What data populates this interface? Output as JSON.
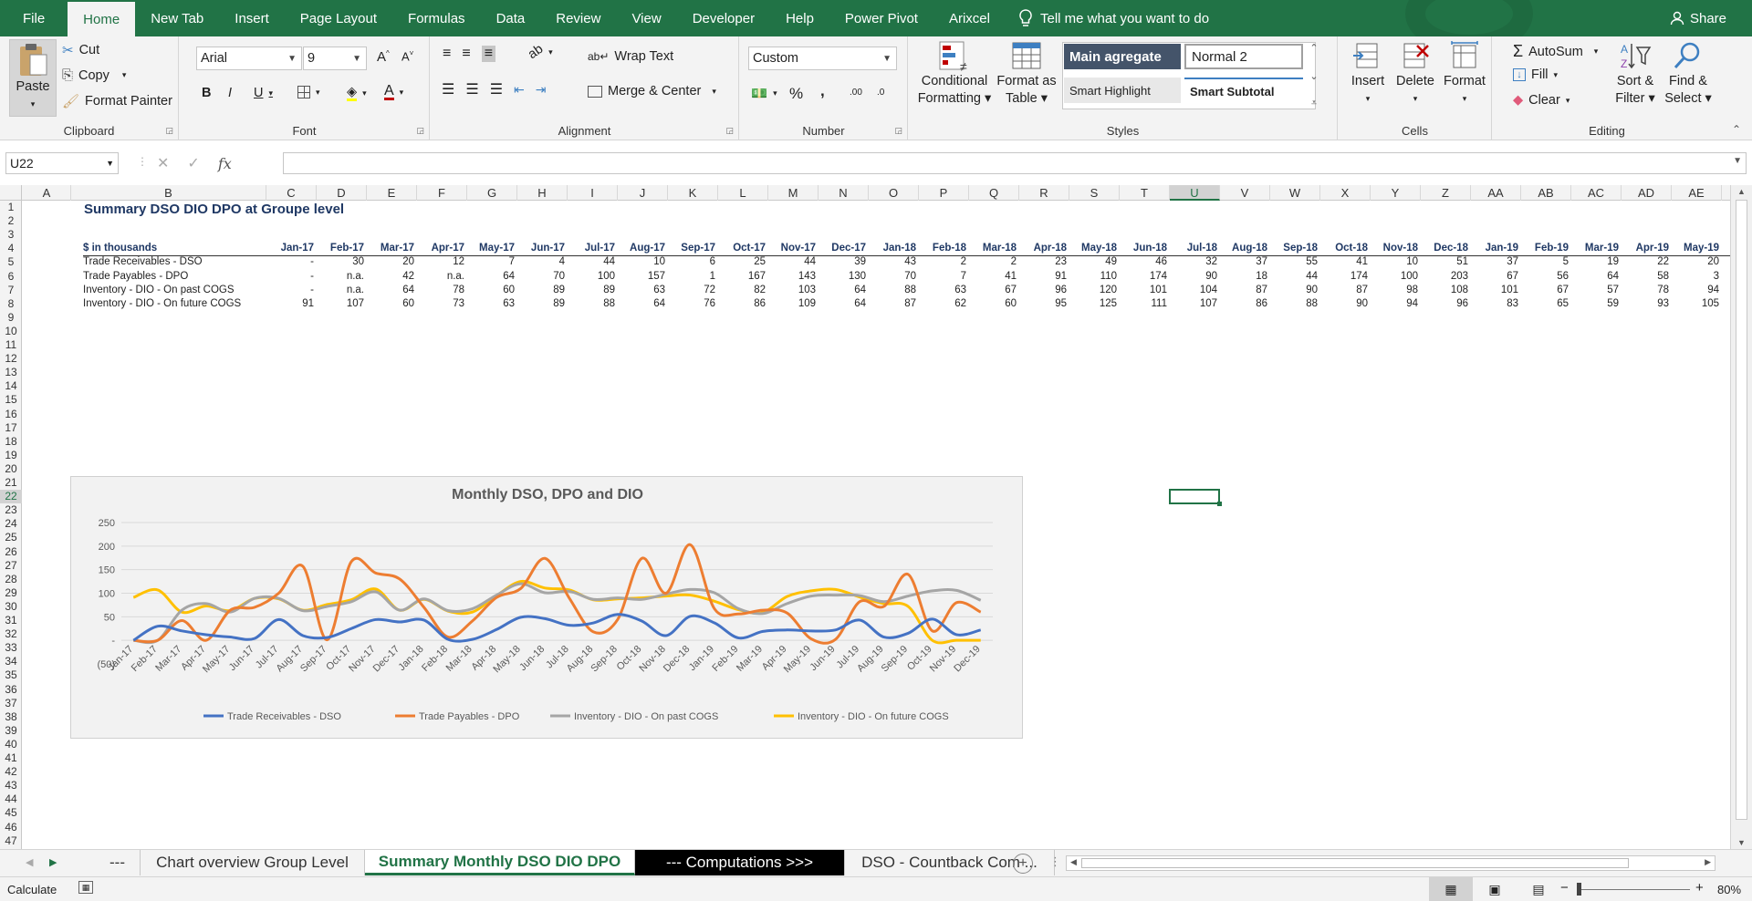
{
  "menu": {
    "file": "File",
    "tabs": [
      "Home",
      "New Tab",
      "Insert",
      "Page Layout",
      "Formulas",
      "Data",
      "Review",
      "View",
      "Developer",
      "Help",
      "Power Pivot",
      "Arixcel"
    ],
    "tell_me": "Tell me what you want to do",
    "share": "Share"
  },
  "ribbon": {
    "clipboard": {
      "paste": "Paste",
      "cut": "Cut",
      "copy": "Copy",
      "format_painter": "Format Painter",
      "label": "Clipboard"
    },
    "font": {
      "name": "Arial",
      "size": "9",
      "bold": "B",
      "italic": "I",
      "underline": "U",
      "label": "Font"
    },
    "alignment": {
      "wrap_text": "Wrap Text",
      "merge_center": "Merge & Center",
      "label": "Alignment"
    },
    "number": {
      "format": "Custom",
      "percent": "%",
      "comma": ",",
      "inc_decimal": ".00",
      "dec_decimal": ".0",
      "label": "Number"
    },
    "styles": {
      "conditional_formatting": [
        "Conditional",
        "Formatting"
      ],
      "format_as_table": [
        "Format as",
        "Table"
      ],
      "gallery": [
        "Main agregate",
        "Normal 2",
        "Smart Highlight",
        "Smart Subtotal"
      ],
      "label": "Styles"
    },
    "cells": {
      "insert": "Insert",
      "delete": "Delete",
      "format": "Format",
      "label": "Cells"
    },
    "editing": {
      "autosum": "AutoSum",
      "fill": "Fill",
      "clear": "Clear",
      "sort_filter": [
        "Sort &",
        "Filter"
      ],
      "find_select": [
        "Find &",
        "Select"
      ],
      "label": "Editing"
    }
  },
  "formula_bar": {
    "name_box": "U22",
    "cancel": "✕",
    "enter": "✓",
    "fx": "fx",
    "formula": ""
  },
  "columns": [
    "A",
    "B",
    "C",
    "D",
    "E",
    "F",
    "G",
    "H",
    "I",
    "J",
    "K",
    "L",
    "M",
    "N",
    "O",
    "P",
    "Q",
    "R",
    "S",
    "T",
    "U",
    "V",
    "W",
    "X",
    "Y",
    "Z",
    "AA",
    "AB",
    "AC",
    "AD",
    "AE"
  ],
  "selected_column": "U",
  "selected_row": 22,
  "row_count": 47,
  "sheet": {
    "title": "Summary DSO DIO DPO at Groupe level",
    "header_label": "$ in thousands",
    "months": [
      "Jan-17",
      "Feb-17",
      "Mar-17",
      "Apr-17",
      "May-17",
      "Jun-17",
      "Jul-17",
      "Aug-17",
      "Sep-17",
      "Oct-17",
      "Nov-17",
      "Dec-17",
      "Jan-18",
      "Feb-18",
      "Mar-18",
      "Apr-18",
      "May-18",
      "Jun-18",
      "Jul-18",
      "Aug-18",
      "Sep-18",
      "Oct-18",
      "Nov-18",
      "Dec-18",
      "Jan-19",
      "Feb-19",
      "Mar-19",
      "Apr-19",
      "May-19"
    ],
    "rows": [
      {
        "label": "Trade Receivables - DSO",
        "values": [
          "-",
          "30",
          "20",
          "12",
          "7",
          "4",
          "44",
          "10",
          "6",
          "25",
          "44",
          "39",
          "43",
          "2",
          "2",
          "23",
          "49",
          "46",
          "32",
          "37",
          "55",
          "41",
          "10",
          "51",
          "37",
          "5",
          "19",
          "22",
          "20"
        ]
      },
      {
        "label": "Trade Payables - DPO",
        "values": [
          "-",
          "n.a.",
          "42",
          "n.a.",
          "64",
          "70",
          "100",
          "157",
          "1",
          "167",
          "143",
          "130",
          "70",
          "7",
          "41",
          "91",
          "110",
          "174",
          "90",
          "18",
          "44",
          "174",
          "100",
          "203",
          "67",
          "56",
          "64",
          "58",
          "3"
        ]
      },
      {
        "label": "Inventory - DIO - On past COGS",
        "values": [
          "-",
          "n.a.",
          "64",
          "78",
          "60",
          "89",
          "89",
          "63",
          "72",
          "82",
          "103",
          "64",
          "88",
          "63",
          "67",
          "96",
          "120",
          "101",
          "104",
          "87",
          "90",
          "87",
          "98",
          "108",
          "101",
          "67",
          "57",
          "78",
          "94"
        ]
      },
      {
        "label": "Inventory - DIO - On future COGS",
        "values": [
          "91",
          "107",
          "60",
          "73",
          "63",
          "89",
          "88",
          "64",
          "76",
          "86",
          "109",
          "64",
          "87",
          "62",
          "60",
          "95",
          "125",
          "111",
          "107",
          "86",
          "88",
          "90",
          "94",
          "96",
          "83",
          "65",
          "59",
          "93",
          "105"
        ]
      }
    ]
  },
  "chart_data": {
    "type": "line",
    "title": "Monthly DSO, DPO and DIO",
    "categories": [
      "Jan-17",
      "Feb-17",
      "Mar-17",
      "Apr-17",
      "May-17",
      "Jun-17",
      "Jul-17",
      "Aug-17",
      "Sep-17",
      "Oct-17",
      "Nov-17",
      "Dec-17",
      "Jan-18",
      "Feb-18",
      "Mar-18",
      "Apr-18",
      "May-18",
      "Jun-18",
      "Jul-18",
      "Aug-18",
      "Sep-18",
      "Oct-18",
      "Nov-18",
      "Dec-18",
      "Jan-19",
      "Feb-19",
      "Mar-19",
      "Apr-19",
      "May-19",
      "Jun-19",
      "Jul-19",
      "Aug-19",
      "Sep-19",
      "Oct-19",
      "Nov-19",
      "Dec-19"
    ],
    "y_ticks": [
      "250",
      "200",
      "150",
      "100",
      "50",
      "-",
      "(50)"
    ],
    "ylim": [
      -50,
      250
    ],
    "grid": true,
    "legend_position": "bottom",
    "series": [
      {
        "name": "Trade Receivables - DSO",
        "color": "#4472c4",
        "values": [
          0,
          30,
          20,
          12,
          7,
          4,
          44,
          10,
          6,
          25,
          44,
          39,
          43,
          2,
          2,
          23,
          49,
          46,
          32,
          37,
          55,
          41,
          10,
          51,
          37,
          5,
          19,
          22,
          20,
          22,
          43,
          7,
          15,
          45,
          12,
          22
        ]
      },
      {
        "name": "Trade Payables - DPO",
        "color": "#ed7d31",
        "values": [
          0,
          0,
          42,
          0,
          64,
          70,
          100,
          157,
          1,
          167,
          143,
          130,
          70,
          7,
          41,
          91,
          110,
          174,
          90,
          18,
          44,
          174,
          100,
          203,
          67,
          56,
          64,
          58,
          3,
          2,
          82,
          72,
          140,
          20,
          80,
          60
        ]
      },
      {
        "name": "Inventory - DIO - On past COGS",
        "color": "#a5a5a5",
        "values": [
          0,
          0,
          64,
          78,
          60,
          89,
          89,
          63,
          72,
          82,
          103,
          64,
          88,
          63,
          67,
          96,
          120,
          101,
          104,
          87,
          90,
          87,
          98,
          108,
          101,
          67,
          57,
          78,
          94,
          96,
          95,
          82,
          94,
          105,
          106,
          85
        ]
      },
      {
        "name": "Inventory - DIO - On future COGS",
        "color": "#ffc000",
        "values": [
          91,
          107,
          60,
          73,
          63,
          89,
          88,
          64,
          76,
          86,
          109,
          64,
          87,
          62,
          60,
          95,
          125,
          111,
          107,
          86,
          88,
          90,
          94,
          96,
          83,
          65,
          59,
          93,
          105,
          108,
          92,
          78,
          72,
          0,
          0,
          0
        ]
      }
    ]
  },
  "sheet_tabs": [
    "---",
    "Chart overview Group Level",
    "Summary Monthly DSO DIO DPO",
    "--- Computations >>>",
    "DSO - Countback Com ..."
  ],
  "active_sheet": "Summary Monthly DSO DIO DPO",
  "status": {
    "mode": "Calculate",
    "zoom": "80%",
    "zoom_level": 0.8
  },
  "colors": {
    "brand": "#217346",
    "header_text": "#1f3864",
    "style_main_bg": "#44546a"
  }
}
